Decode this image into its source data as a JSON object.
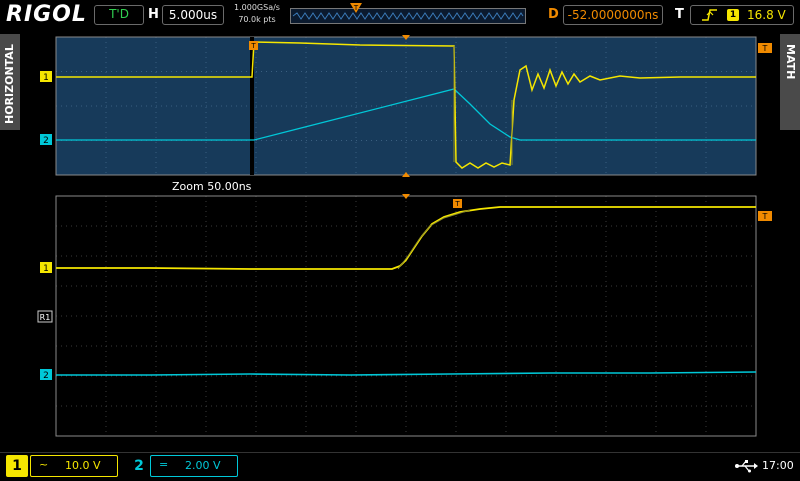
{
  "header": {
    "brand": "RIGOL",
    "run_state": "T'D",
    "horizontal_label": "H",
    "timebase": "5.000us",
    "sample_rate": "1.000GSa/s",
    "memory_depth": "70.0k pts",
    "delay_label": "D",
    "delay": "-52.0000000ns",
    "trigger_label": "T",
    "trigger_source": "1",
    "trigger_level": "16.8 V",
    "trigger_edge_icon": "rising-edge-icon"
  },
  "side_tabs": {
    "left": "HORIZONTAL",
    "right": "MATH"
  },
  "main_view": {
    "ch1_marker": "1",
    "ch2_marker": "2",
    "trigger_marker": "T",
    "zoom_label": "Zoom  50.00ns"
  },
  "zoom_view": {
    "ch1_marker": "1",
    "ch2_marker": "2",
    "ref_marker": "R1",
    "trigger_marker": "T"
  },
  "footer": {
    "ch1_number": "1",
    "ch1_coupling": "~",
    "ch1_scale": "10.0 V",
    "ch2_number": "2",
    "ch2_coupling": "=",
    "ch2_scale": "2.00 V",
    "usb_icon": "usb-icon",
    "time": "17:00"
  },
  "colors": {
    "ch1": "#f5e600",
    "ch2": "#00c8d8",
    "trigger": "#f08a00",
    "grid_bg_main": "#173a5a",
    "grid_bg_zoom": "#000000"
  }
}
